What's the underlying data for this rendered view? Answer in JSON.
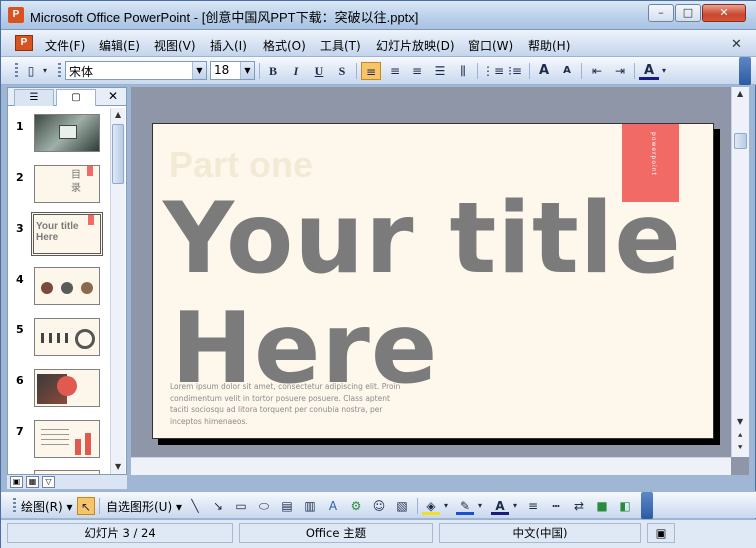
{
  "window": {
    "title": "Microsoft Office PowerPoint - [创意中国风PPT下载：突破以往.pptx]",
    "minimize_label": "–",
    "maximize_label": "□",
    "close_label": "✕"
  },
  "menubar": {
    "items": [
      "文件(F)",
      "编辑(E)",
      "视图(V)",
      "插入(I)",
      "格式(O)",
      "工具(T)",
      "幻灯片放映(D)",
      "窗口(W)",
      "帮助(H)"
    ],
    "close_label": "✕"
  },
  "toolbar": {
    "font_name": "宋体",
    "font_size": "18",
    "bold": "B",
    "italic": "I",
    "underline": "U",
    "shadow": "S",
    "increase_font": "A",
    "decrease_font": "A",
    "font_color": "A"
  },
  "left_pane": {
    "tab_outline": "☰",
    "tab_slides": "▢",
    "close_label": "✕",
    "thumbnails": [
      {
        "num": "1",
        "text": ""
      },
      {
        "num": "2",
        "text": "目\n录"
      },
      {
        "num": "3",
        "text": "Your title Here"
      },
      {
        "num": "4",
        "text": ""
      },
      {
        "num": "5",
        "text": ""
      },
      {
        "num": "6",
        "text": ""
      },
      {
        "num": "7",
        "text": ""
      }
    ]
  },
  "slide": {
    "part_label": "Part one",
    "title_line1": "Your title",
    "title_line2": "Here",
    "red_block_text": "powerpoint",
    "body_text": "Lorem ipsum dolor sit amet, consectetur adipiscing elit. Proin condimentum velit in tortor posuere posuere. Class aptent taciti sociosqu ad litora torquent per conubia nostra, per inceptos himenaeos.",
    "accent_color": "#f26a66",
    "title_color": "#7b7b7b"
  },
  "drawbar": {
    "draw_label": "绘图(R) ▾",
    "autoshape_label": "自选图形(U) ▾"
  },
  "statusbar": {
    "slide_info": "幻灯片 3 / 24",
    "theme": "Office 主题",
    "language": "中文(中国)"
  }
}
